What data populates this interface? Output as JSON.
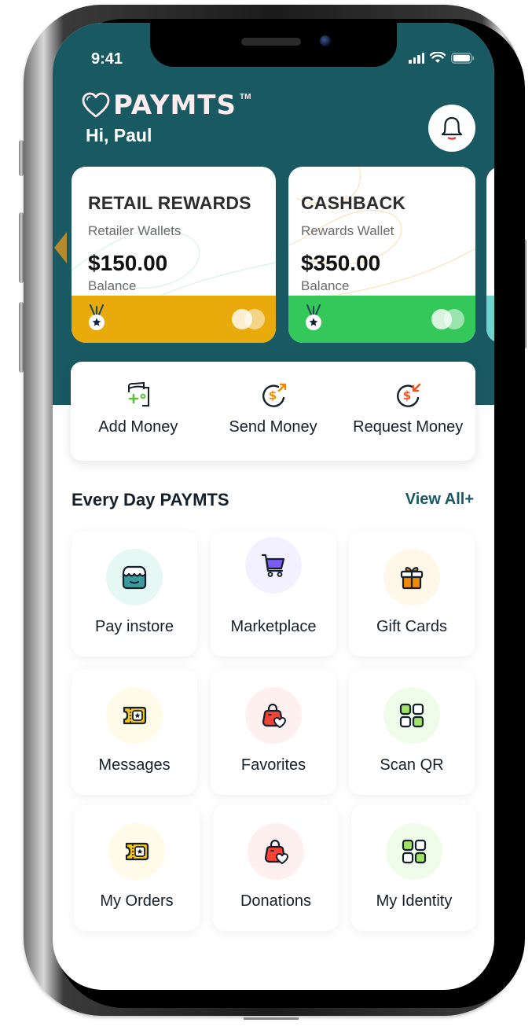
{
  "status_bar": {
    "time": "9:41"
  },
  "header": {
    "brand": "PAYMTS",
    "trademark": "TM",
    "greeting": "Hi, Paul"
  },
  "wallets": [
    {
      "title": "RETAIL REWARDS",
      "subtitle": "Retailer Wallets",
      "amount": "$150.00",
      "amount_label": "Balance",
      "band_color": "#e9aa0b",
      "swirl_color": "#bfe7e4"
    },
    {
      "title": "CASHBACK",
      "subtitle": "Rewards Wallet",
      "amount": "$350.00",
      "amount_label": "Balance",
      "band_color": "#34c85a",
      "swirl_color": "#ffd9a8"
    }
  ],
  "peek_wallet": {
    "band_color": "#6dd3cc"
  },
  "quick_actions": [
    {
      "label": "Add Money",
      "icon": "wallet-add-icon"
    },
    {
      "label": "Send Money",
      "icon": "send-money-icon"
    },
    {
      "label": "Request Money",
      "icon": "request-money-icon"
    }
  ],
  "everyday": {
    "title": "Every Day PAYMTS",
    "view_all": "View All+",
    "tiles": [
      {
        "label": "Pay instore",
        "icon": "store-icon",
        "bg": "#e6f8f4"
      },
      {
        "label": "Marketplace",
        "icon": "cart-icon",
        "bg": "#f3f1ff"
      },
      {
        "label": "Gift Cards",
        "icon": "gift-icon",
        "bg": "#fff8e9"
      },
      {
        "label": "Messages",
        "icon": "ticket-icon",
        "bg": "#fffbe8"
      },
      {
        "label": "Favorites",
        "icon": "bag-heart-icon",
        "bg": "#fff0f0"
      },
      {
        "label": "Scan QR",
        "icon": "grid-icon",
        "bg": "#effcea"
      },
      {
        "label": "My Orders",
        "icon": "ticket-icon",
        "bg": "#fffbe8"
      },
      {
        "label": "Donations",
        "icon": "bag-heart-icon",
        "bg": "#fff0f0"
      },
      {
        "label": "My Identity",
        "icon": "grid-icon",
        "bg": "#effcea"
      }
    ]
  },
  "colors": {
    "brand_teal": "#195962",
    "text_dark": "#15202b",
    "accent_orange": "#f08a00",
    "accent_red": "#f44336",
    "accent_green": "#5ec33b"
  }
}
